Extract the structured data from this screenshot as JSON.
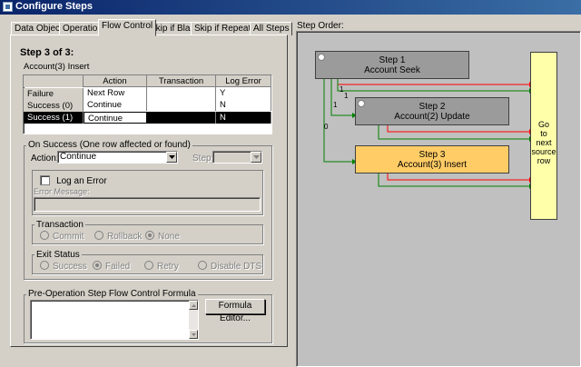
{
  "window": {
    "title": "Configure Steps"
  },
  "tabs": [
    "Data Objects",
    "Operation",
    "Flow Control",
    "Skip if Blank",
    "Skip if Repeated",
    "All Steps"
  ],
  "active_tab": "Flow Control",
  "step_header": {
    "title": "Step 3 of 3:",
    "subtitle": "Account(3) Insert"
  },
  "grid": {
    "columns": [
      "Action",
      "Transaction",
      "Log Error"
    ],
    "rows": [
      {
        "label": "Failure",
        "action": "Next Row",
        "transaction": "",
        "log_error": "Y"
      },
      {
        "label": "Success (0)",
        "action": "Continue",
        "transaction": "",
        "log_error": "N"
      },
      {
        "label": "Success (1)",
        "action": "Continue",
        "transaction": "",
        "log_error": "N"
      }
    ]
  },
  "on_success": {
    "group_label": "On Success (One row affected or found)",
    "action_label": "Action:",
    "action_value": "Continue",
    "step_label": "Step:",
    "log_error_label": "Log an Error",
    "error_message_label": "Error Message:",
    "transaction_label": "Transaction",
    "transaction_options": [
      "Commit",
      "Rollback",
      "None"
    ],
    "transaction_selected": "None",
    "exit_status_label": "Exit Status",
    "exit_status_options": [
      "Success",
      "Failed",
      "Retry",
      "Disable DTS"
    ],
    "exit_status_selected": "Failed"
  },
  "formula": {
    "group_label": "Pre-Operation Step Flow Control Formula",
    "editor_button": "Formula Editor..."
  },
  "step_order": {
    "label": "Step Order:",
    "steps": [
      {
        "name": "Step 1",
        "detail": "Account Seek"
      },
      {
        "name": "Step 2",
        "detail": "Account(2) Update"
      },
      {
        "name": "Step 3",
        "detail": "Account(3) Insert"
      }
    ],
    "end_node": "Go to next source row",
    "edge_labels": [
      "1",
      "1",
      "1",
      "0"
    ]
  },
  "colors": {
    "step_node": "#9b9b9b",
    "active_step": "#ffcc66",
    "end_node": "#ffffaa",
    "success_edge": "#008000",
    "failure_edge": "#ff0000",
    "canvas": "#c0c0c0"
  }
}
